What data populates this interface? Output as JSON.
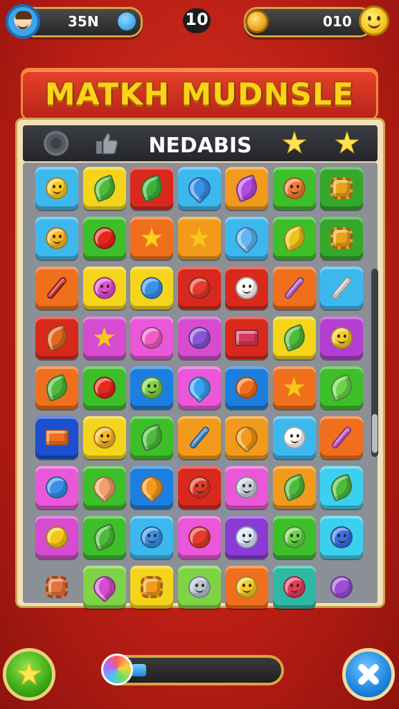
{
  "top_bar": {
    "player_value": "35N",
    "moves": "10",
    "coins": "010",
    "accent": "#d9a441"
  },
  "title": "MATKH MUDNSLE",
  "board": {
    "header_title": "NEDABIS",
    "header_icons": [
      "ring-icon",
      "thumbs-up-icon",
      "star-icon",
      "star-icon"
    ],
    "rows": [
      [
        [
          "#3cb8ef",
          "face",
          "#f7cc2a"
        ],
        [
          "#f5d41c",
          "leaf",
          "#4dbb3b"
        ],
        [
          "#d9291c",
          "leaf",
          "#3bb33e"
        ],
        [
          "#3cb8ef",
          "drop",
          "#3a8fe6"
        ],
        [
          "#f29a1c",
          "leaf",
          "#b64adf"
        ],
        [
          "#3dbf2a",
          "face",
          "#f07c3a"
        ],
        [
          "#35a82b",
          "gear",
          "#e8a21a"
        ]
      ],
      [
        [
          "#3cb8ef",
          "face",
          "#f7b92a"
        ],
        [
          "#3dbf2a",
          "ball",
          "#e3281e"
        ],
        [
          "#f06f1d",
          "starshape",
          "#f7d21a"
        ],
        [
          "#f29a1c",
          "starshape",
          "#f7c717"
        ],
        [
          "#3cb8ef",
          "drop",
          "#5eb6f2"
        ],
        [
          "#3dbf2a",
          "leaf",
          "#f0c21a"
        ],
        [
          "#35a82b",
          "gear",
          "#e8a21a"
        ]
      ],
      [
        [
          "#f06f1d",
          "stick",
          "#d8261c"
        ],
        [
          "#f5d41c",
          "face",
          "#e04fd6"
        ],
        [
          "#f5d41c",
          "ball",
          "#3a8fe6"
        ],
        [
          "#d9291c",
          "ball",
          "#e33b2c"
        ],
        [
          "#d9291c",
          "face",
          "#ffffff"
        ],
        [
          "#f06f1d",
          "stick",
          "#c95bd8"
        ],
        [
          "#3cb8ef",
          "stick",
          "#eaeaea"
        ]
      ],
      [
        [
          "#d9291c",
          "leaf",
          "#e3671e"
        ],
        [
          "#d64bd0",
          "starshape",
          "#f7c717"
        ],
        [
          "#ea58d9",
          "ball",
          "#f25cc4"
        ],
        [
          "#d64bd0",
          "ball",
          "#8a55d6"
        ],
        [
          "#d9291c",
          "box",
          "#d8385c"
        ],
        [
          "#f5d41c",
          "leaf",
          "#4dbb3b"
        ],
        [
          "#b43ed4",
          "face",
          "#f7cc2a"
        ]
      ],
      [
        [
          "#f06f1d",
          "leaf",
          "#4dbb3b"
        ],
        [
          "#3dbf2a",
          "ball",
          "#e3281e"
        ],
        [
          "#1b7fe0",
          "face",
          "#7ed347"
        ],
        [
          "#ea58d9",
          "drop",
          "#3aa3ef"
        ],
        [
          "#1b7fe0",
          "ball",
          "#f06f1d"
        ],
        [
          "#f06f1d",
          "starshape",
          "#f7c717"
        ],
        [
          "#3dbf2a",
          "leaf",
          "#6ad54a"
        ]
      ],
      [
        [
          "#1b4fcf",
          "box",
          "#f06f1d"
        ],
        [
          "#f5d41c",
          "face",
          "#f7b92a"
        ],
        [
          "#3dbf2a",
          "leaf",
          "#4dbb3b"
        ],
        [
          "#f29a1c",
          "stick",
          "#3a8fe6"
        ],
        [
          "#f29a1c",
          "drop",
          "#f29a1c"
        ],
        [
          "#3cb8ef",
          "face",
          "#ffffff"
        ],
        [
          "#f06f1d",
          "stick",
          "#d64bd0"
        ]
      ],
      [
        [
          "#ea58d9",
          "ball",
          "#3a8fe6"
        ],
        [
          "#3dbf2a",
          "drop",
          "#f0a06a"
        ],
        [
          "#1b7fe0",
          "drop",
          "#f29a1c"
        ],
        [
          "#d9291c",
          "face",
          "#e33b2c"
        ],
        [
          "#ea58d9",
          "face",
          "#c9d1e0"
        ],
        [
          "#f29a1c",
          "leaf",
          "#4dbb3b"
        ],
        [
          "#3cd0ef",
          "leaf",
          "#4dbb3b"
        ]
      ],
      [
        [
          "#d64bd0",
          "ball",
          "#f7c717"
        ],
        [
          "#3dbf2a",
          "leaf",
          "#4dbb3b"
        ],
        [
          "#3cb8ef",
          "face",
          "#3a8fe6"
        ],
        [
          "#ea58d9",
          "ball",
          "#e33b2c"
        ],
        [
          "#8a3bd6",
          "face",
          "#dbe8ff"
        ],
        [
          "#3dbf2a",
          "face",
          "#6ad54a"
        ],
        [
          "#3cd0ef",
          "face",
          "#3a6fe6"
        ]
      ],
      [
        [
          "transparent",
          "gear",
          "#e0743a"
        ],
        [
          "#7ed347",
          "drop",
          "#d64bd0"
        ],
        [
          "#f5d41c",
          "gear",
          "#f29a1c"
        ],
        [
          "#7ed347",
          "face",
          "#b8c4d6"
        ],
        [
          "#f06f1d",
          "face",
          "#f7cc2a"
        ],
        [
          "#2fb8a3",
          "face",
          "#e33b5c"
        ],
        [
          "transparent",
          "ball",
          "#9a4fd6"
        ]
      ]
    ]
  },
  "progress": {
    "fraction": 0.1
  },
  "buttons": [
    "star-button",
    "close-button"
  ]
}
